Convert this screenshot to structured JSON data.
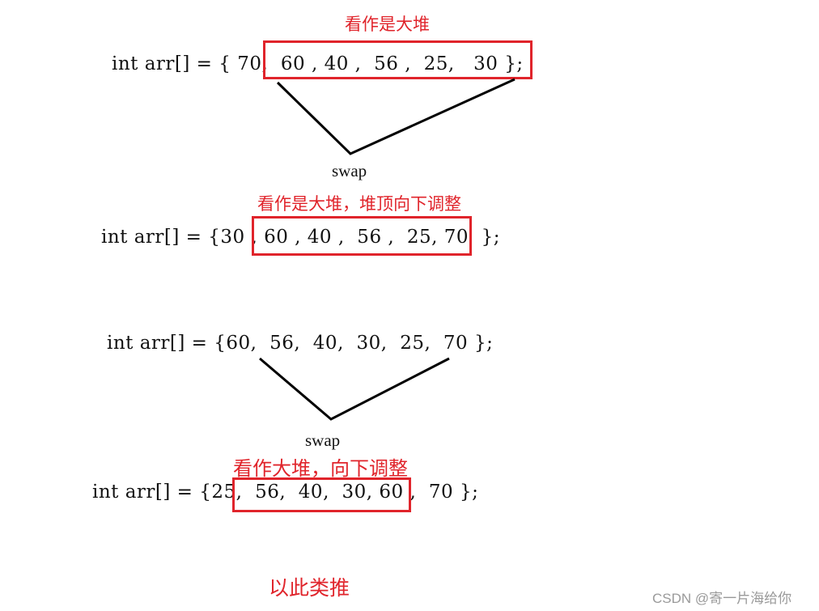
{
  "colors": {
    "accent": "#e0242b",
    "text": "#111111",
    "watermark": "#9a9a9a"
  },
  "steps": [
    {
      "note": "看作是大堆",
      "code": "int arr[] = { 70,  60 , 40 ,  56 ,  25,   30 };",
      "array": [
        70,
        60,
        40,
        56,
        25,
        30
      ],
      "highlighted": [
        70,
        60,
        40,
        56,
        25,
        30
      ],
      "swap_label": "swap",
      "swap_between": [
        70,
        30
      ]
    },
    {
      "note": "看作是大堆，堆顶向下调整",
      "code": "int arr[] = {30 , 60 , 40 ,  56 ,  25, 70  };",
      "array": [
        30,
        60,
        40,
        56,
        25,
        70
      ],
      "highlighted": [
        30,
        60,
        40,
        56,
        25
      ]
    },
    {
      "code": "int arr[] = {60,  56,  40,  30,  25,  70 };",
      "array": [
        60,
        56,
        40,
        30,
        25,
        70
      ],
      "swap_label": "swap",
      "swap_between": [
        60,
        25
      ]
    },
    {
      "note": "看作大堆，向下调整",
      "code": "int arr[] = {25,  56,  40,  30, 60 ,  70 };",
      "array": [
        25,
        56,
        40,
        30,
        60,
        70
      ],
      "highlighted": [
        25,
        56,
        40,
        30
      ]
    }
  ],
  "footer_note": "以此类推",
  "watermark": "CSDN @寄一片海给你"
}
